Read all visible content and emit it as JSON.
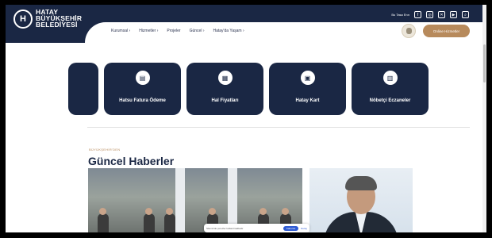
{
  "header": {
    "logo_mark": "H",
    "logo_lines": [
      "HATAY",
      "BÜYÜKŞEHİR",
      "BELEDİYESİ"
    ],
    "utility_label": "Bu Tasa Enn",
    "social_icons": [
      "facebook-icon",
      "instagram-icon",
      "twitter-icon",
      "youtube-icon",
      "search-icon"
    ],
    "cta_label": "Online Hizmetler"
  },
  "nav": {
    "items": [
      "Kurumsal ›",
      "Hizmetler ›",
      "Projeler",
      "Güncel ›",
      "Hatay'da Yaşam ›"
    ]
  },
  "quick_links": [
    {
      "label": "",
      "icon": "card-icon"
    },
    {
      "label": "Hatsu Fatura Ödeme",
      "icon": "invoice-icon"
    },
    {
      "label": "Hal Fiyatları",
      "icon": "market-icon"
    },
    {
      "label": "Hatay Kart",
      "icon": "card-icon"
    },
    {
      "label": "Nöbetçi Eczaneler",
      "icon": "pharmacy-icon"
    }
  ],
  "news": {
    "kicker": "BÜYÜKŞEHİR'DEN",
    "title": "Güncel Haberler"
  },
  "cookie": {
    "text": "Sitemizde çerezler kullanılmaktadır",
    "accept_label": "Kabul Et",
    "link_label": "Detay"
  },
  "colors": {
    "navy": "#1a2744",
    "accent": "#b78a5c"
  }
}
